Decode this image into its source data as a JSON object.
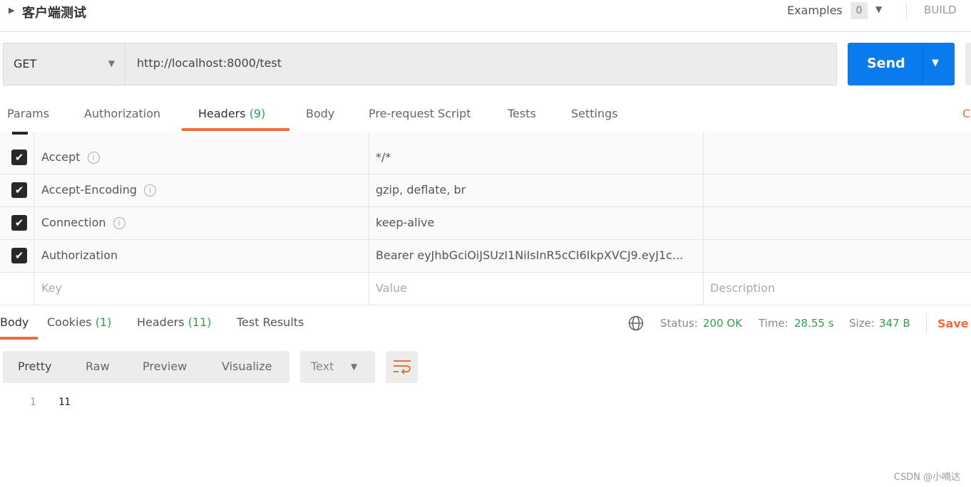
{
  "header": {
    "title": "客户端测试",
    "examples_label": "Examples",
    "examples_count": "0",
    "build_label": "BUILD"
  },
  "request": {
    "method": "GET",
    "url": "http://localhost:8000/test",
    "send_label": "Send"
  },
  "tabs": [
    {
      "label": "Params"
    },
    {
      "label": "Authorization"
    },
    {
      "label": "Headers",
      "count": "(9)"
    },
    {
      "label": "Body"
    },
    {
      "label": "Pre-request Script"
    },
    {
      "label": "Tests"
    },
    {
      "label": "Settings"
    }
  ],
  "cookies_link": "C",
  "headers": [
    {
      "key": "Accept",
      "value": "*/*"
    },
    {
      "key": "Accept-Encoding",
      "value": "gzip, deflate, br"
    },
    {
      "key": "Connection",
      "value": "keep-alive"
    },
    {
      "key": "Authorization",
      "value": "Bearer eyJhbGciOiJSUzI1NiIsInR5cCI6IkpXVCJ9.eyJ1c..."
    }
  ],
  "new_row": {
    "key_placeholder": "Key",
    "value_placeholder": "Value",
    "description_placeholder": "Description"
  },
  "response": {
    "tabs": [
      {
        "label": "Body"
      },
      {
        "label": "Cookies",
        "count": "(1)"
      },
      {
        "label": "Headers",
        "count": "(11)"
      },
      {
        "label": "Test Results"
      }
    ],
    "status_label": "Status:",
    "status": "200 OK",
    "time_label": "Time:",
    "time": "28.55 s",
    "size_label": "Size:",
    "size": "347 B",
    "save_label": "Save",
    "views": [
      "Pretty",
      "Raw",
      "Preview",
      "Visualize"
    ],
    "format": "Text",
    "lines": [
      {
        "num": "1",
        "text": "11"
      }
    ]
  },
  "watermark": "CSDN @小嘀达",
  "colors": {
    "accent": "#f26b3a",
    "send": "#097bed",
    "success": "#2f9e55"
  }
}
